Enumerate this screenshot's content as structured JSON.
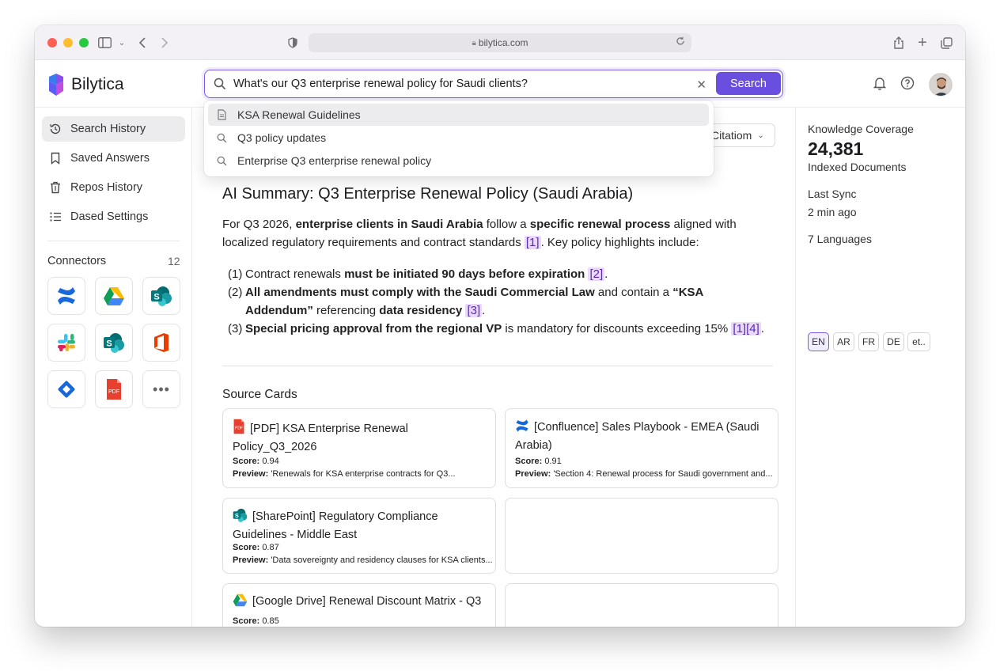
{
  "browser": {
    "url": "bilytica.com"
  },
  "app": {
    "name": "Bilytica"
  },
  "search": {
    "value": "What's our Q3 enterprise renewal policy for Saudi clients?",
    "button": "Search",
    "suggestions": [
      {
        "icon": "document-icon",
        "label": "KSA Renewal Guidelines"
      },
      {
        "icon": "search-icon",
        "label": "Q3 policy updates"
      },
      {
        "icon": "search-icon",
        "label": "Enterprise Q3 enterprise renewal policy"
      }
    ]
  },
  "sidebar": {
    "items": [
      {
        "icon": "history-icon",
        "label": "Search History"
      },
      {
        "icon": "bookmark-icon",
        "label": "Saved Answers"
      },
      {
        "icon": "trash-icon",
        "label": "Repos History"
      },
      {
        "icon": "list-icon",
        "label": "Dased Settings"
      }
    ],
    "connectors_title": "Connectors",
    "connectors_count": "12",
    "connectors": [
      "confluence",
      "google-drive",
      "sharepoint",
      "slack",
      "sharepoint",
      "office",
      "jira",
      "pdf",
      "more"
    ]
  },
  "main": {
    "citation_label": "Citatiom",
    "summary_title": "AI Summary: Q3 Enterprise Renewal Policy (Saudi Arabia)",
    "para": {
      "t1": "For Q3 2026, ",
      "b1": "enterprise clients in Saudi Arabia",
      "t2": " follow a ",
      "b2": "specific renewal process",
      "t3": " aligned with localized regulatory requirements and contract standards ",
      "c1": "[1]",
      "t4": ". Key policy highlights include:"
    },
    "list": [
      {
        "num": "(1)",
        "pre": "Contract renewals ",
        "bold": "must be initiated 90 days before expiration",
        "post": " ",
        "cite": "[2]",
        "end": "."
      },
      {
        "num": "(2)",
        "pre": "",
        "bold": "All amendments must comply with the Saudi Commercial Law",
        "post": " and contain a ",
        "bold2": "“KSA Addendum”",
        "post2": " referencing ",
        "bold3": "data residency",
        "post3": " ",
        "cite": "[3]",
        "end": "."
      },
      {
        "num": "(3)",
        "pre": "",
        "bold": "Special pricing approval from the regional VP",
        "post": " is mandatory for discounts exceeding 15% ",
        "cite": "[1][4]",
        "end": "."
      }
    ],
    "source_title": "Source Cards",
    "cards": [
      {
        "icon": "pdf-icon",
        "title": "[PDF] KSA Enterprise Renewal Policy_Q3_2026",
        "score_label": "Score:",
        "score": "0.94",
        "preview_label": "Preview:",
        "preview": "'Renewals for KSA enterprise contracts for Q3..."
      },
      {
        "icon": "confluence-icon",
        "title": "[Confluence] Sales Playbook - EMEA (Saudi Arabia)",
        "score_label": "Score:",
        "score": "0.91",
        "preview_label": "Preview:",
        "preview": "'Section 4: Renewal process for Saudi government and..."
      },
      {
        "icon": "sharepoint-icon",
        "title": "[SharePoint] Regulatory Compliance Guidelines - Middle East",
        "score_label": "Score:",
        "score": "0.87",
        "preview_label": "Preview:",
        "preview": "'Data sovereignty and residency clauses for KSA clients..."
      },
      {
        "icon": "google-drive-icon",
        "title": "[Google Drive] Renewal Discount Matrix - Q3",
        "score_label": "Score:",
        "score": "0.85"
      }
    ]
  },
  "right_panel": {
    "coverage_label": "Knowledge Coverage",
    "coverage_value": "24,381",
    "coverage_sub": "Indexed Documents",
    "sync_label": "Last Sync",
    "sync_value": "2 min ago",
    "languages_label": "7 Languages",
    "languages": [
      "EN",
      "AR",
      "FR",
      "DE",
      "et.."
    ]
  },
  "colors": {
    "accent": "#6a4ee0",
    "cite_bg": "#ead9fb"
  }
}
